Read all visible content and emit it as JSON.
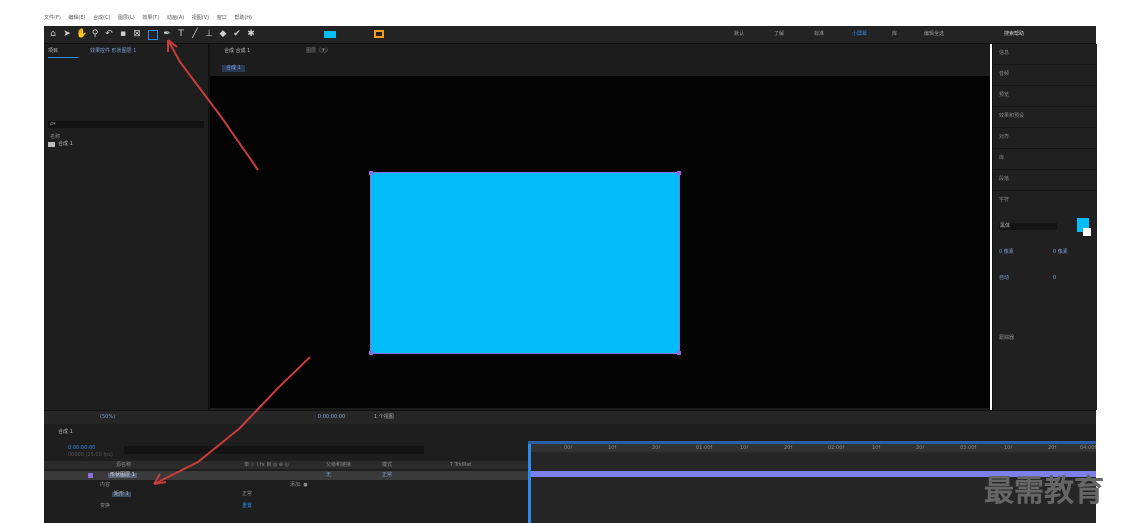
{
  "menubar": {
    "items": [
      "文件(F)",
      "编辑(E)",
      "合成(C)",
      "图层(L)",
      "效果(T)",
      "动画(A)",
      "视图(V)",
      "窗口",
      "帮助(H)"
    ]
  },
  "toolbar": {
    "right_items": [
      "默认",
      "了解",
      "标准",
      "小屏幕",
      "库",
      "编辑全选"
    ],
    "search_placeholder": "搜索帮助"
  },
  "project": {
    "tab_label": "项目",
    "effects_tab_label": "效果控件 形状图层 1",
    "search_icon_text": "ρ▾",
    "col_name": "名称",
    "item_label": "合成 1"
  },
  "viewer": {
    "tab_label": "合成 合成 1",
    "layer_tab_label": "图层（无）",
    "comp_label": "合成 1",
    "zoom_label": "(50%)",
    "timecode": "0:00:00:00",
    "view_label": "1 个视图"
  },
  "right_panel": {
    "items": [
      "信息",
      "音频",
      "预览",
      "效果和预设",
      "对齐",
      "库",
      "段落",
      "字符"
    ],
    "tracker_label": "跟踪器",
    "font_label": "黑体",
    "text_row_values": [
      "0 像素",
      "0 像素",
      "自动",
      "0"
    ]
  },
  "timeline": {
    "tab_label": "合成 1",
    "timecode": "0:00:00:00",
    "frame_label": "00000 (25.00 fps)",
    "col_source": "源名称",
    "col_switch": "单 ☆ \\ fx 目 ◎ ⊕ ◎",
    "col_parent": "父级和链接",
    "col_mode": "模式",
    "col_trk": "T TrkMat",
    "layer_name": "形状图层 1",
    "layer_mode": "正常",
    "layer_parent": "无",
    "content_label": "内容",
    "add_label": "添加: ●",
    "transform_label": "变换",
    "reset_label": "重置",
    "shape_item": "矩形 1",
    "shape_mode": "正常",
    "ruler_ticks": [
      "00f",
      "10f",
      "20f",
      "01:00f",
      "10f",
      "20f",
      "02:00f",
      "10f",
      "20f",
      "03:00f",
      "10f",
      "20f",
      "04:00f"
    ]
  },
  "colors": {
    "shape_fill": "#03bdf9",
    "selection": "#8b6fe0",
    "accent_blue": "#2d8ceb",
    "arrow": "#c83c3c",
    "track_bar": "#7f7fe9"
  },
  "watermark": "最需教育"
}
